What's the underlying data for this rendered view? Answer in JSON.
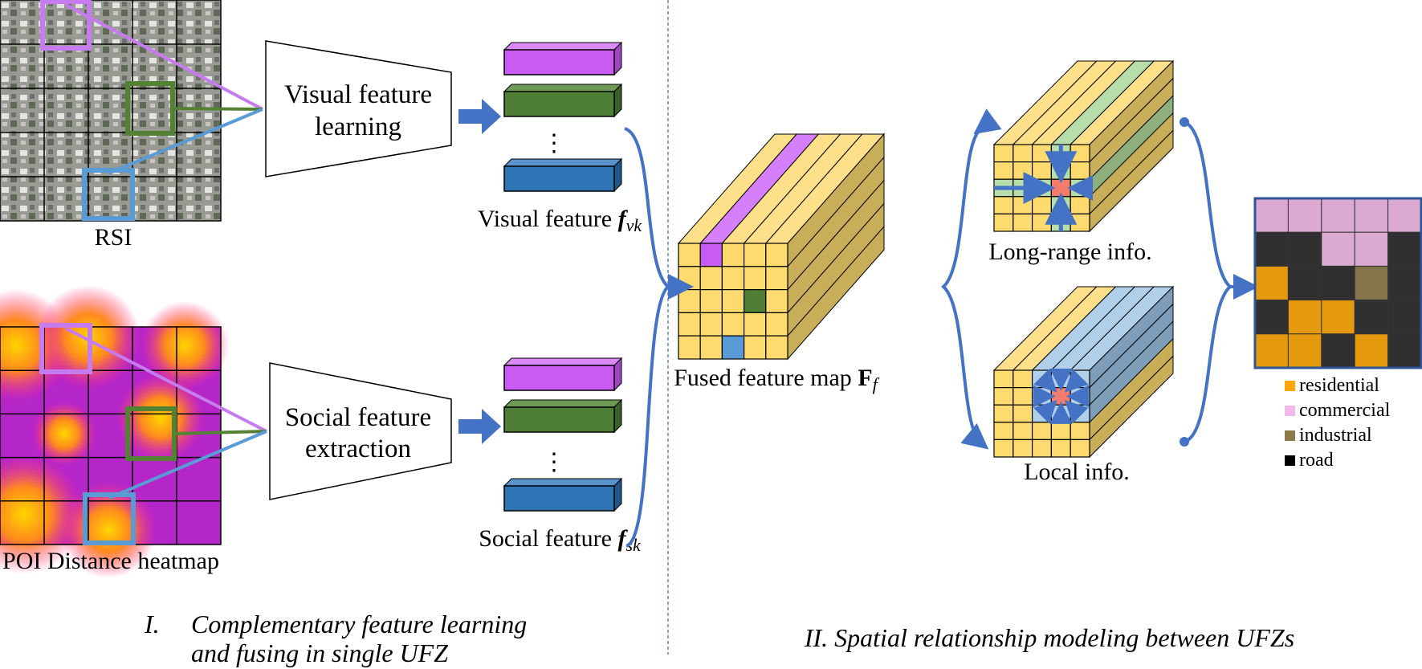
{
  "left": {
    "rsi_label": "RSI",
    "heatmap_label": "POI Distance heatmap",
    "visual_module": [
      "Visual feature",
      "learning"
    ],
    "social_module": [
      "Social feature",
      "extraction"
    ],
    "visual_feature_label": "Visual feature ",
    "visual_feature_symbol": "f",
    "visual_feature_sub": "vk",
    "social_feature_label": "Social feature ",
    "social_feature_symbol": "f",
    "social_feature_sub": "sk",
    "dots": "⋮",
    "caption_num": "I.",
    "caption_line1": "Complementary feature learning",
    "caption_line2": "and fusing in single UFZ"
  },
  "right": {
    "fused_label": "Fused feature map ",
    "fused_symbol": "F",
    "fused_sub": "f",
    "long_range_label": "Long-range info.",
    "local_label": "Local info.",
    "caption": "II. Spatial relationship modeling between UFZs"
  },
  "legend": [
    {
      "label": "residential",
      "color": "#FFA500"
    },
    {
      "label": "commercial",
      "color": "#F4B8E8"
    },
    {
      "label": "industrial",
      "color": "#8C7A4B"
    },
    {
      "label": "road",
      "color": "#000000"
    }
  ],
  "output_map": [
    [
      "commercial",
      "commercial",
      "commercial",
      "commercial",
      "commercial"
    ],
    [
      "road",
      "road",
      "commercial",
      "commercial",
      "road"
    ],
    [
      "residential",
      "road",
      "road",
      "industrial",
      "road"
    ],
    [
      "road",
      "residential",
      "residential",
      "road",
      "road"
    ],
    [
      "residential",
      "residential",
      "road",
      "residential",
      "road"
    ]
  ],
  "colors": {
    "purple": "#C95BF5",
    "green": "#4F7F34",
    "blue": "#2E75B6",
    "box_blue": "#5B9BD5",
    "arrow": "#4472C4",
    "yellow": "#FFDA6E",
    "red": "#F47C6C"
  }
}
